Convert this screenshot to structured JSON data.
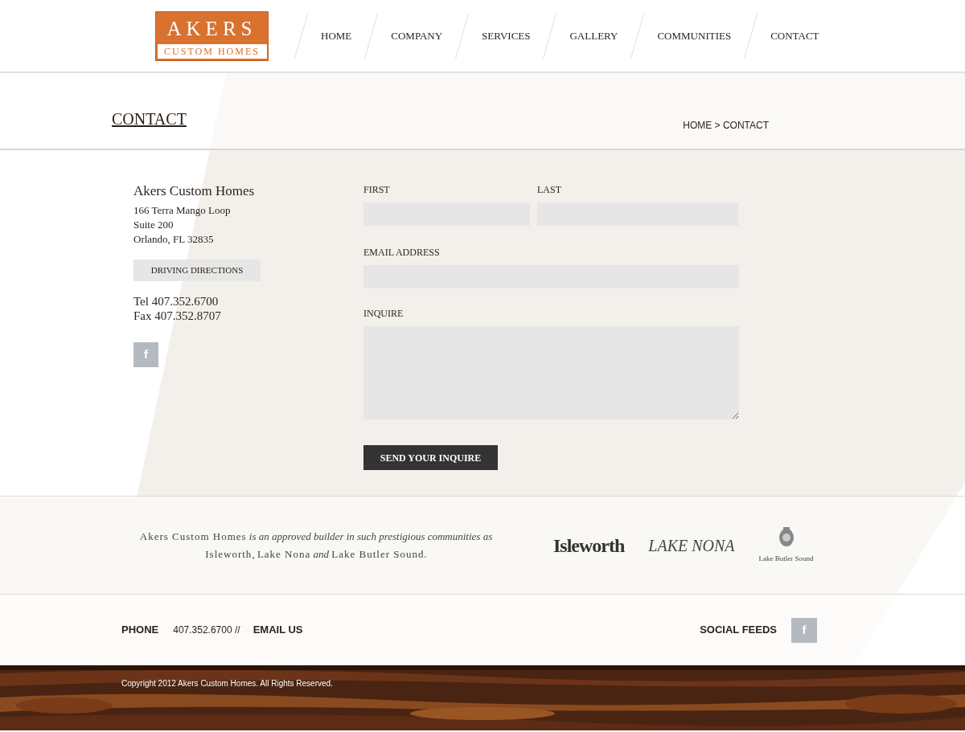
{
  "logo": {
    "line_1": "AKERS",
    "line_2": "CUSTOM HOMES"
  },
  "nav": [
    {
      "label": "HOME"
    },
    {
      "label": "COMPANY"
    },
    {
      "label": "SERVICES"
    },
    {
      "label": "GALLERY"
    },
    {
      "label": "COMMUNITIES"
    },
    {
      "label": "CONTACT"
    }
  ],
  "page_title": "CONTACT",
  "breadcrumb": "HOME > CONTACT",
  "address": {
    "name": "Akers Custom Homes",
    "lines": [
      "166 Terra Mango Loop",
      "Suite 200",
      "Orlando, FL 32835"
    ],
    "directions_button": "DRIVING DIRECTIONS",
    "tel": "Tel 407.352.6700",
    "fax": "Fax 407.352.8707",
    "social_icon": "f"
  },
  "form": {
    "first_label": "FIRST",
    "last_label": "LAST",
    "email_label": "EMAIL ADDRESS",
    "inquire_label": "INQUIRE",
    "submit": "SEND YOUR INQUIRE"
  },
  "partners": {
    "blurb": "**Akers Custom Homes** is an approved builder in such prestigious communities as **Isleworth**, **Lake Nona** and **Lake Butler Sound**.",
    "logos": [
      {
        "kind": "isleworth",
        "text": "Isleworth"
      },
      {
        "kind": "lakenona",
        "text": "LAKE NONA"
      },
      {
        "kind": "butler",
        "text": "Lake Butler Sound"
      }
    ]
  },
  "footer": {
    "phone_label": "PHONE",
    "phone": "407.352.6700 //",
    "email": "EMAIL US",
    "social_label": "SOCIAL FEEDS",
    "social_icon": "f",
    "copyright": "Copyright 2012 Akers Custom Homes. All Rights Reserved."
  }
}
